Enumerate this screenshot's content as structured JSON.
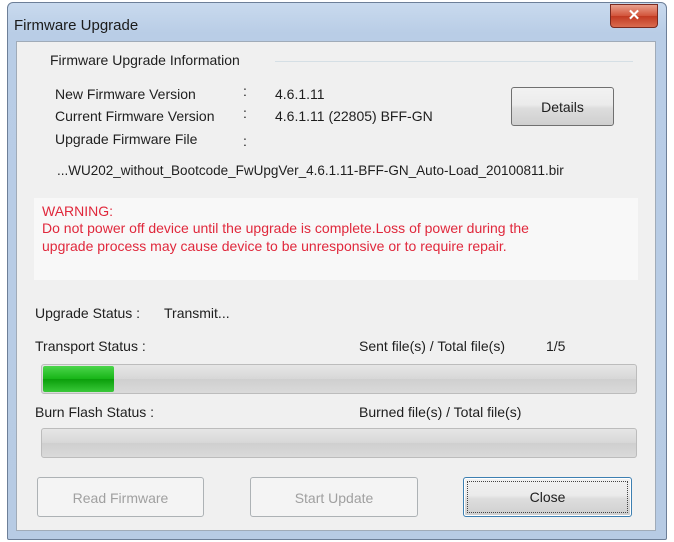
{
  "window": {
    "title": "Firmware Upgrade",
    "close_glyph": "✕"
  },
  "info": {
    "group_title": "Firmware Upgrade Information",
    "new_version_label": "New Firmware Version",
    "new_version_colon": ":",
    "new_version_value": "4.6.1.11",
    "current_version_label": "Current  Firmware Version",
    "current_version_colon": ":",
    "current_version_value": "4.6.1.11 (22805) BFF-GN",
    "file_label": "Upgrade Firmware File",
    "file_colon": ":",
    "file_value": "...WU202_without_Bootcode_FwUpgVer_4.6.1.11-BFF-GN_Auto-Load_20100811.bir",
    "details_button": "Details"
  },
  "warning": {
    "heading": "WARNING:",
    "line1": " Do not power off device until the upgrade is complete.Loss of power during the",
    "line2": "upgrade process may cause device to be unresponsive or to require repair."
  },
  "status": {
    "upgrade_label": "Upgrade Status :",
    "upgrade_value": "Transmit...",
    "transport_label": "Transport Status :",
    "transport_counter_label": "Sent file(s) / Total file(s)",
    "transport_counter_value": "1/5",
    "transport_progress": 0.12,
    "burn_label": "Burn Flash Status :",
    "burn_counter_label": "Burned file(s) / Total file(s)",
    "burn_progress": 0
  },
  "buttons": {
    "read_firmware": "Read Firmware",
    "start_update": "Start Update",
    "close": "Close"
  },
  "colors": {
    "warning": "#e0283c",
    "progress_fill": "#17b517",
    "title_bar": "#c9daee"
  }
}
